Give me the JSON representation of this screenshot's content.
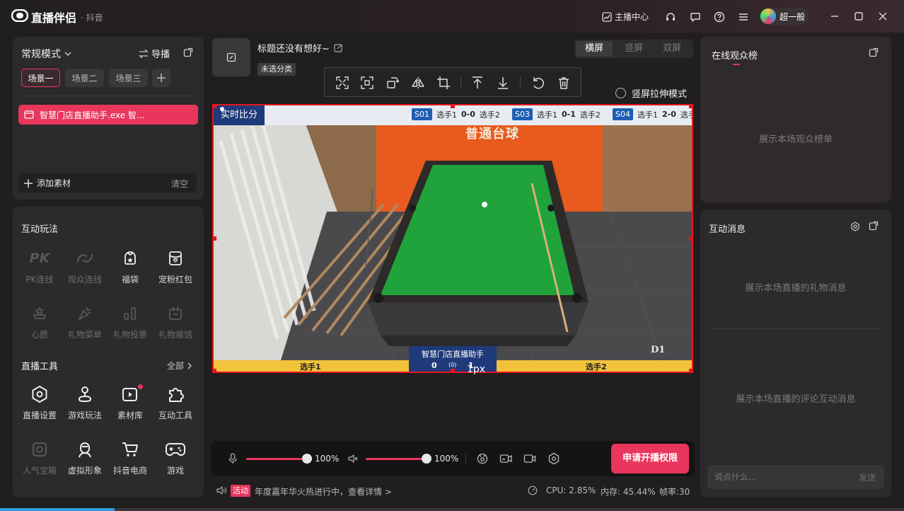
{
  "app": {
    "name": "直播伴侣",
    "platform": "· 抖音"
  },
  "titlebar": {
    "creator_center": "主播中心",
    "username": "超一般"
  },
  "left": {
    "mode": "常规模式",
    "guide": "导播",
    "scenes": [
      "场景一",
      "场景二",
      "场景三"
    ],
    "source_item": "智慧门店直播助手.exe 智...",
    "add_material": "添加素材",
    "clear": "清空",
    "interactive_title": "互动玩法",
    "interactive": [
      {
        "label": "PK连线",
        "icon": "pk-icon",
        "enabled": false
      },
      {
        "label": "观众连线",
        "icon": "audience-link-icon",
        "enabled": false
      },
      {
        "label": "福袋",
        "icon": "lucky-bag-icon",
        "enabled": true
      },
      {
        "label": "宠粉红包",
        "icon": "red-packet-icon",
        "enabled": true
      },
      {
        "label": "心愿",
        "icon": "wish-icon",
        "enabled": false
      },
      {
        "label": "礼物菜单",
        "icon": "gift-menu-icon",
        "enabled": false
      },
      {
        "label": "礼物投票",
        "icon": "gift-vote-icon",
        "enabled": false
      },
      {
        "label": "礼物展馆",
        "icon": "gift-gallery-icon",
        "enabled": false
      }
    ],
    "tools_title": "直播工具",
    "all": "全部",
    "tools": [
      {
        "label": "直播设置",
        "icon": "settings-icon",
        "enabled": true
      },
      {
        "label": "游戏玩法",
        "icon": "game-play-icon",
        "enabled": true
      },
      {
        "label": "素材库",
        "icon": "material-library-icon",
        "enabled": true
      },
      {
        "label": "互动工具",
        "icon": "puzzle-icon",
        "enabled": true
      },
      {
        "label": "人气宝箱",
        "icon": "treasure-box-icon",
        "enabled": false
      },
      {
        "label": "虚拟形象",
        "icon": "avatar-icon",
        "enabled": true
      },
      {
        "label": "抖音电商",
        "icon": "cart-icon",
        "enabled": true
      },
      {
        "label": "游戏",
        "icon": "gamepad-icon",
        "enabled": true
      }
    ]
  },
  "center": {
    "title": "标题还没有想好~",
    "category": "未选分类",
    "orientation_tabs": [
      "横屏",
      "竖屏",
      "双屏"
    ],
    "stretch_mode": "竖屏拉伸模式",
    "size_label": "1px"
  },
  "overlay": {
    "realtime_score": "实时比分",
    "matches": [
      {
        "id": "S01",
        "p1": "选手1",
        "score": "0-0",
        "p2": "选手2"
      },
      {
        "id": "S03",
        "p1": "选手1",
        "score": "0-1",
        "p2": "选手2"
      },
      {
        "id": "S04",
        "p1": "选手1",
        "score": "2-0",
        "p2": "选手2"
      }
    ],
    "wall_sign": "普通台球",
    "table_tag": "D1",
    "bottom": {
      "title": "智慧门店直播助手",
      "left_player": "选手1",
      "right_player": "选手2",
      "score_left": "0",
      "score_mid": "(0)",
      "score_right": "1"
    }
  },
  "bottombar": {
    "mic_volume": "100%",
    "speaker_volume": "100%",
    "mic_level": 1.0,
    "speaker_level": 1.0,
    "start_button": "申请开播权限"
  },
  "status": {
    "badge": "活动",
    "notice": "年度嘉年华火热进行中，查看详情 >",
    "cpu": "CPU: 2.85%",
    "memory": "内存: 45.44%",
    "fps": "帧率:30"
  },
  "right": {
    "viewers_title": "在线观众榜",
    "viewers_empty": "展示本场观众榜单",
    "messages_title": "互动消息",
    "gift_empty": "展示本场直播的礼物消息",
    "comment_empty": "展示本场直播的评论互动消息",
    "input_placeholder": "说点什么...",
    "send": "发送"
  },
  "colors": {
    "accent": "#e8365c",
    "panel": "#2c2a2c",
    "felt": "#1fa33a",
    "wall": "#e8561f",
    "score_blue": "#1f5fb3",
    "score_yellow": "#f2c23a"
  }
}
